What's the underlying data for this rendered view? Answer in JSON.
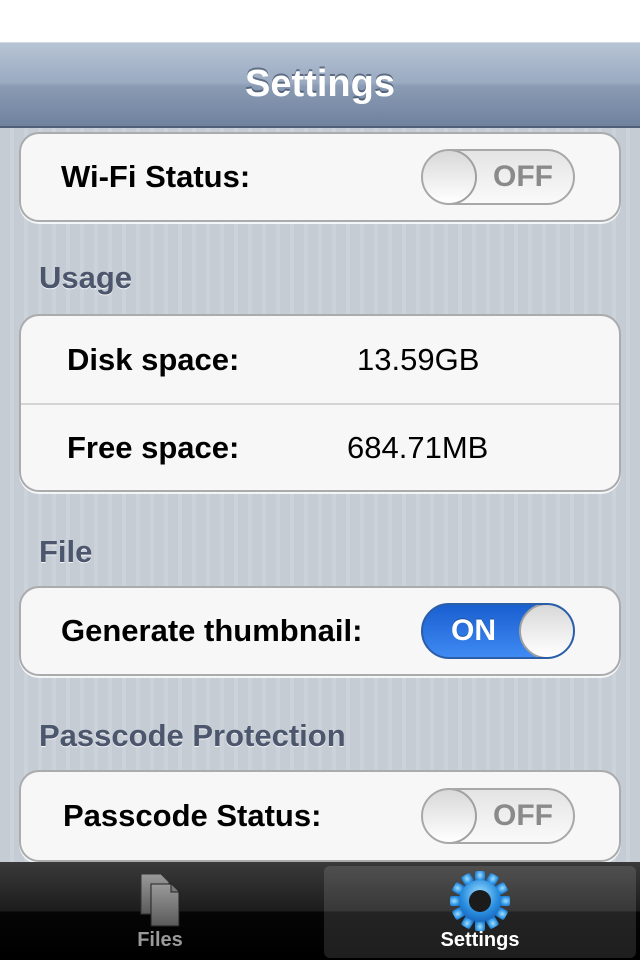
{
  "navbar": {
    "title": "Settings"
  },
  "wifi": {
    "label": "Wi-Fi Status:",
    "toggle_text": "OFF",
    "state": "off"
  },
  "usage": {
    "header": "Usage",
    "disk_label": "Disk space:",
    "disk_value": "13.59GB",
    "free_label": "Free space:",
    "free_value": "684.71MB"
  },
  "file": {
    "header": "File",
    "thumbnail_label": "Generate thumbnail:",
    "toggle_text": "ON",
    "state": "on"
  },
  "passcode": {
    "header": "Passcode Protection",
    "label": "Passcode Status:",
    "toggle_text": "OFF",
    "state": "off"
  },
  "tabbar": {
    "tabs": [
      {
        "label": "Files",
        "icon": "files-icon",
        "selected": false
      },
      {
        "label": "Settings",
        "icon": "gear-icon",
        "selected": true
      }
    ]
  },
  "colors": {
    "navbar": "#8a9bb3",
    "toggle_on": "#2f78e8",
    "section_header": "#4c566c",
    "background": "#c5ccd4"
  }
}
